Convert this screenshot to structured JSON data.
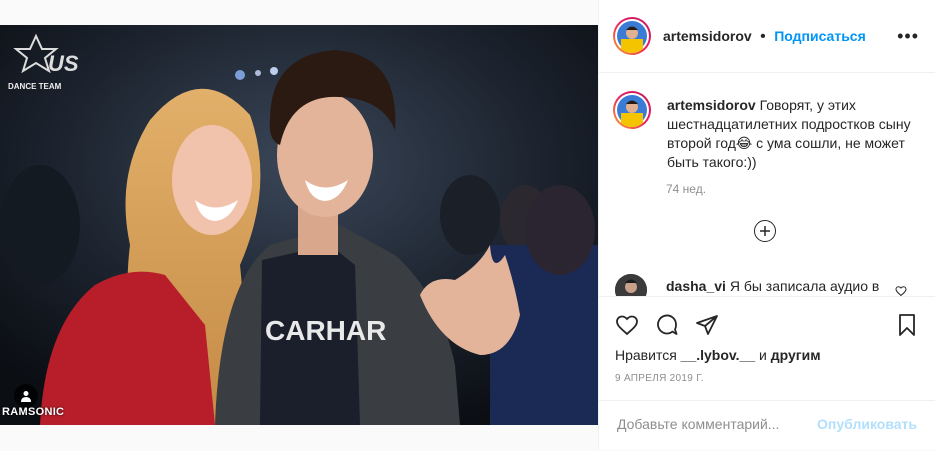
{
  "photo": {
    "logo_text": "DANCE TEAM",
    "credit": "RAMSONIC",
    "shirt_text": "CARHAR"
  },
  "post": {
    "username": "artemsidorov",
    "separator": "•",
    "follow_label": "Подписаться",
    "more_label": "•••",
    "caption_text": "Говорят, у этих шестнадцатилетних подростков сыну второй год😂 с ума сошли, не может быть такого:))",
    "time_ago": "74 нед.",
    "comment": {
      "username": "dasha_vi",
      "text": "Я бы записала аудио в"
    },
    "likes_prefix": "Нравится ",
    "likes_user": "__.lybov.__",
    "likes_middle": " и ",
    "likes_suffix": "другим",
    "date": "9 АПРЕЛЯ 2019 Г.",
    "comment_placeholder": "Добавьте комментарий...",
    "publish_label": "Опубликовать"
  },
  "colors": {
    "accent": "#0095f6",
    "publish_disabled": "#b2dffc",
    "muted": "#8e8e8e"
  },
  "icons": [
    "heart-icon",
    "comment-icon",
    "share-icon",
    "bookmark-icon",
    "plus-circle-icon",
    "user-tag-icon",
    "more-icon"
  ]
}
